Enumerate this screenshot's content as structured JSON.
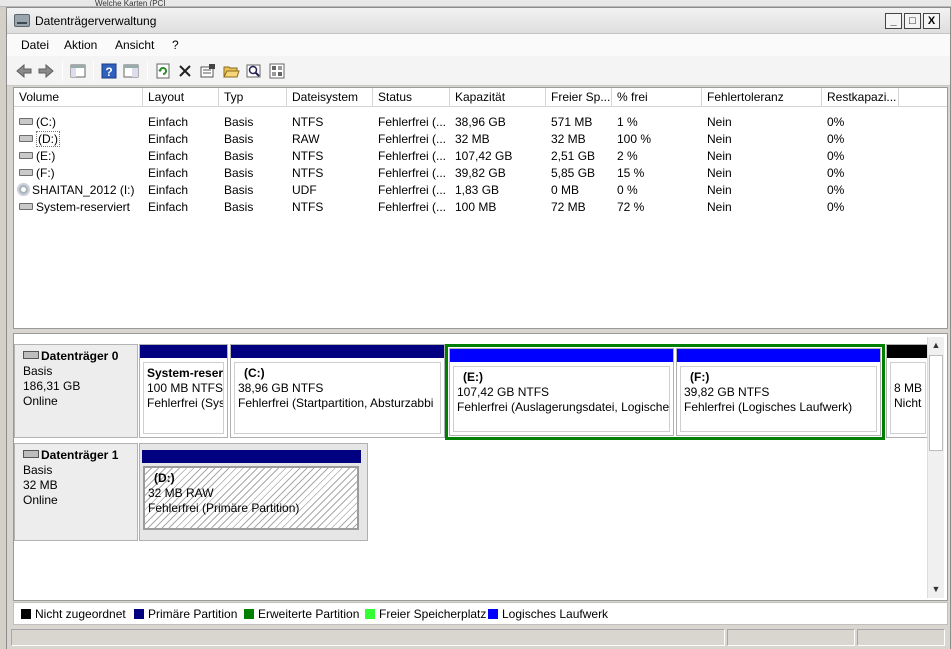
{
  "background_window": {
    "text": "Welche Karten (PCI"
  },
  "window": {
    "title": "Datenträgerverwaltung"
  },
  "window_controls": {
    "minimize": "_",
    "maximize": "□",
    "close": "X"
  },
  "menu": [
    "Datei",
    "Aktion",
    "Ansicht",
    "?"
  ],
  "toolbar": [
    "back-arrow-icon",
    "forward-arrow-icon",
    "console-tree-icon",
    "help-icon",
    "properties-view-icon",
    "refresh-icon",
    "delete-icon",
    "properties-icon",
    "open-folder-icon",
    "search-icon",
    "settings-icon"
  ],
  "columns": [
    "Volume",
    "Layout",
    "Typ",
    "Dateisystem",
    "Status",
    "Kapazität",
    "Freier Sp...",
    "% frei",
    "Fehlertoleranz",
    "Restkapazi..."
  ],
  "volumes": [
    {
      "name": "(C:)",
      "layout": "Einfach",
      "typ": "Basis",
      "fs": "NTFS",
      "status": "Fehlerfrei (...",
      "cap": "38,96 GB",
      "free": "571 MB",
      "pct": "1 %",
      "ft": "Nein",
      "rest": "0%"
    },
    {
      "name": "(D:)",
      "layout": "Einfach",
      "typ": "Basis",
      "fs": "RAW",
      "status": "Fehlerfrei (...",
      "cap": "32 MB",
      "free": "32 MB",
      "pct": "100 %",
      "ft": "Nein",
      "rest": "0%"
    },
    {
      "name": "(E:)",
      "layout": "Einfach",
      "typ": "Basis",
      "fs": "NTFS",
      "status": "Fehlerfrei (...",
      "cap": "107,42 GB",
      "free": "2,51 GB",
      "pct": "2 %",
      "ft": "Nein",
      "rest": "0%"
    },
    {
      "name": "(F:)",
      "layout": "Einfach",
      "typ": "Basis",
      "fs": "NTFS",
      "status": "Fehlerfrei (...",
      "cap": "39,82 GB",
      "free": "5,85 GB",
      "pct": "15 %",
      "ft": "Nein",
      "rest": "0%"
    },
    {
      "name": "SHAITAN_2012 (I:)",
      "layout": "Einfach",
      "typ": "Basis",
      "fs": "UDF",
      "status": "Fehlerfrei (...",
      "cap": "1,83 GB",
      "free": "0 MB",
      "pct": "0 %",
      "ft": "Nein",
      "rest": "0%"
    },
    {
      "name": "System-reserviert",
      "layout": "Einfach",
      "typ": "Basis",
      "fs": "NTFS",
      "status": "Fehlerfrei (...",
      "cap": "100 MB",
      "free": "72 MB",
      "pct": "72 %",
      "ft": "Nein",
      "rest": "0%"
    }
  ],
  "disks": [
    {
      "name": "Datenträger 0",
      "type": "Basis",
      "size": "186,31 GB",
      "state": "Online",
      "partitions": [
        {
          "name": "System-reser",
          "size": "100 MB NTFS",
          "status": "Fehlerfrei (Syst"
        },
        {
          "name": "(C:)",
          "size": "38,96 GB NTFS",
          "status": "Fehlerfrei (Startpartition, Absturzabbi"
        },
        {
          "name": "(E:)",
          "size": "107,42 GB NTFS",
          "status": "Fehlerfrei (Auslagerungsdatei, Logisches"
        },
        {
          "name": "(F:)",
          "size": "39,82 GB NTFS",
          "status": "Fehlerfrei (Logisches Laufwerk)"
        },
        {
          "name": "",
          "size": "8 MB",
          "status": "Nicht"
        }
      ]
    },
    {
      "name": "Datenträger 1",
      "type": "Basis",
      "size": "32 MB",
      "state": "Online",
      "partitions": [
        {
          "name": "(D:)",
          "size": "32 MB RAW",
          "status": "Fehlerfrei (Primäre Partition)"
        }
      ]
    }
  ],
  "legend": [
    {
      "label": "Nicht zugeordnet",
      "color": "#000000"
    },
    {
      "label": "Primäre Partition",
      "color": "#000080"
    },
    {
      "label": "Erweiterte Partition",
      "color": "#008000"
    },
    {
      "label": "Freier Speicherplatz",
      "color": "#33ff33"
    },
    {
      "label": "Logisches Laufwerk",
      "color": "#0000ff"
    }
  ],
  "colors": {
    "primary_bar": "#000080",
    "logical_bar": "#0000ff",
    "extended_border": "#008000",
    "unallocated_bar": "#000000"
  },
  "scrollbar": {
    "up": "▲",
    "down": "▼"
  }
}
